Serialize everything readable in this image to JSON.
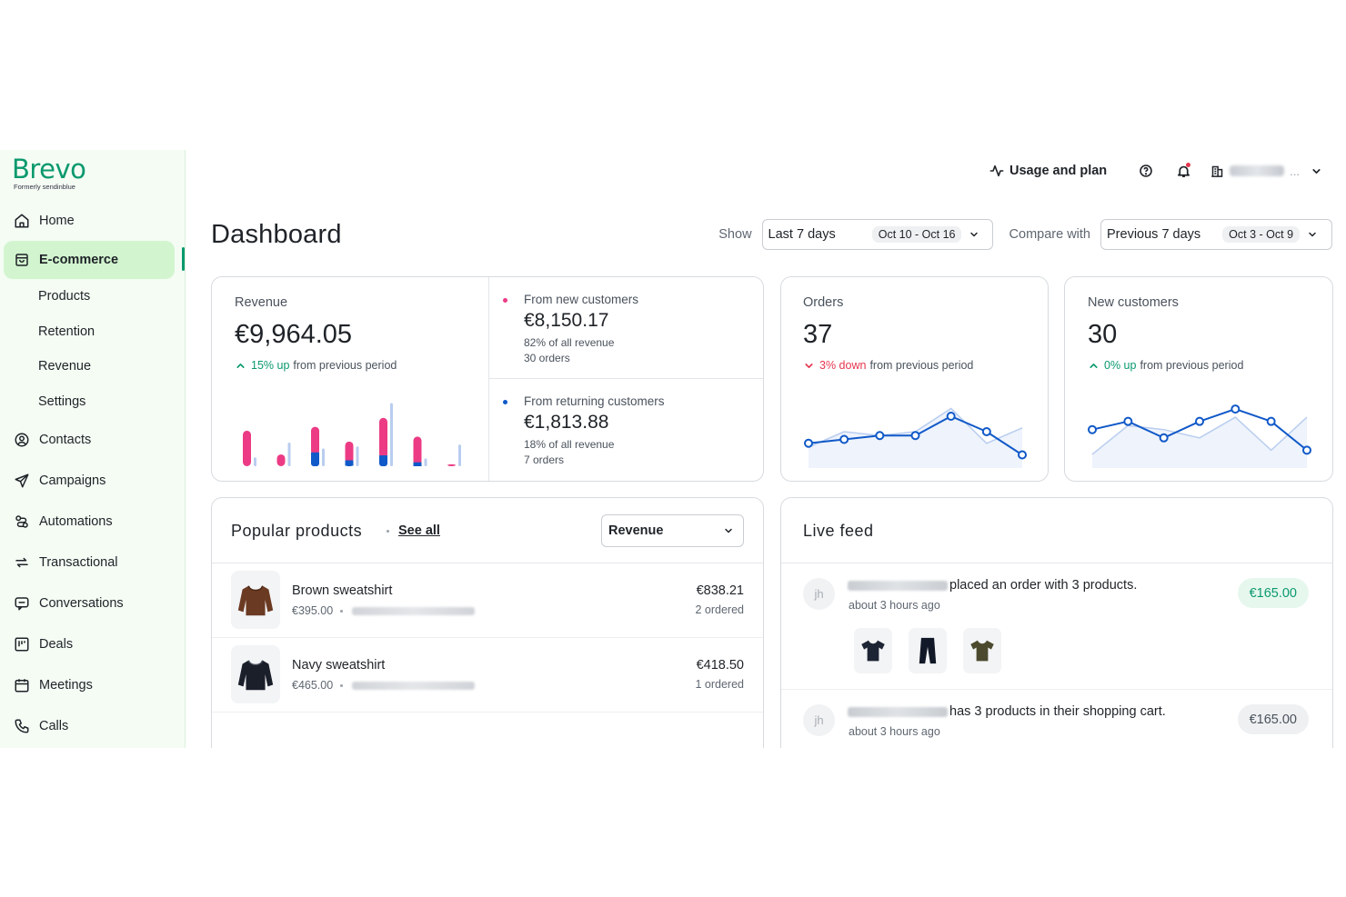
{
  "brand": {
    "name": "Brevo",
    "tagline": "Formerly sendinblue",
    "color": "#0b996e"
  },
  "sidebar": {
    "items": [
      {
        "label": "Home",
        "icon": "home-icon"
      },
      {
        "label": "E-commerce",
        "icon": "shopping-bag-icon",
        "active": true
      },
      {
        "label": "Contacts",
        "icon": "contacts-icon"
      },
      {
        "label": "Campaigns",
        "icon": "send-icon"
      },
      {
        "label": "Automations",
        "icon": "automation-icon"
      },
      {
        "label": "Transactional",
        "icon": "transactional-icon"
      },
      {
        "label": "Conversations",
        "icon": "chat-icon"
      },
      {
        "label": "Deals",
        "icon": "deals-icon"
      },
      {
        "label": "Meetings",
        "icon": "calendar-icon"
      },
      {
        "label": "Calls",
        "icon": "phone-icon"
      }
    ],
    "ecommerce_sub": [
      "Products",
      "Retention",
      "Revenue",
      "Settings"
    ]
  },
  "topbar": {
    "usage_label": "Usage and plan",
    "org_suffix": "..."
  },
  "page": {
    "title": "Dashboard"
  },
  "filters": {
    "show_label": "Show",
    "show_value": "Last 7 days",
    "show_range": "Oct 10 - Oct 16",
    "compare_label": "Compare with",
    "compare_value": "Previous 7 days",
    "compare_range": "Oct 3 - Oct 9"
  },
  "revenue": {
    "label": "Revenue",
    "value": "€9,964.05",
    "delta": "15% up",
    "delta_suffix": "from previous period",
    "new_label": "From new customers",
    "new_value": "€8,150.17",
    "new_share": "82% of all revenue",
    "new_orders": "30 orders",
    "ret_label": "From returning customers",
    "ret_value": "€1,813.88",
    "ret_share": "18% of all revenue",
    "ret_orders": "7 orders",
    "colors": {
      "new": "#ec3b84",
      "returning": "#1059c8",
      "previous": "#b9cdef"
    }
  },
  "orders": {
    "label": "Orders",
    "value": "37",
    "delta": "3% down",
    "delta_suffix": "from previous period"
  },
  "new_customers": {
    "label": "New customers",
    "value": "30",
    "delta": "0% up",
    "delta_suffix": "from previous period"
  },
  "chart_data": [
    {
      "type": "bar",
      "categories": [
        "1",
        "2",
        "3",
        "4",
        "5",
        "6",
        "7"
      ],
      "series": [
        {
          "name": "From new customers",
          "values": [
            36,
            12,
            26,
            19,
            38,
            26,
            2
          ]
        },
        {
          "name": "From returning customers",
          "values": [
            0,
            0,
            14,
            6,
            11,
            4,
            0
          ]
        },
        {
          "name": "Previous period",
          "values": [
            9,
            24,
            18,
            20,
            64,
            8,
            22
          ]
        }
      ],
      "ylim": [
        0,
        70
      ]
    },
    {
      "type": "line",
      "categories": [
        "1",
        "2",
        "3",
        "4",
        "5",
        "6",
        "7"
      ],
      "series": [
        {
          "values": [
            3,
            4,
            5,
            5,
            10,
            6,
            0
          ]
        },
        {
          "values": [
            2,
            6,
            5,
            6,
            12,
            3,
            7
          ]
        }
      ],
      "ylim": [
        -2,
        14
      ]
    },
    {
      "type": "line",
      "categories": [
        "1",
        "2",
        "3",
        "4",
        "5",
        "6",
        "7"
      ],
      "series": [
        {
          "values": [
            7,
            9,
            5,
            9,
            12,
            9,
            2
          ]
        },
        {
          "values": [
            1,
            8,
            7,
            5,
            10,
            2,
            10
          ]
        }
      ],
      "ylim": [
        -1,
        14
      ]
    }
  ],
  "popular": {
    "title": "Popular products",
    "see_all": "See all",
    "metric": "Revenue",
    "products": [
      {
        "name": "Brown sweatshirt",
        "price": "€395.00",
        "revenue": "€838.21",
        "ordered": "2 ordered",
        "color": "#6b3a22"
      },
      {
        "name": "Navy sweatshirt",
        "price": "€465.00",
        "revenue": "€418.50",
        "ordered": "1 ordered",
        "color": "#1b1f2a"
      }
    ]
  },
  "feed": {
    "title": "Live feed",
    "items": [
      {
        "initials": "jh",
        "text": "placed an order with 3 products.",
        "time": "about 3 hours ago",
        "amount": "€165.00"
      },
      {
        "initials": "jh",
        "text": "has 3 products in their shopping cart.",
        "time": "about 3 hours ago",
        "amount": "€165.00"
      }
    ]
  }
}
